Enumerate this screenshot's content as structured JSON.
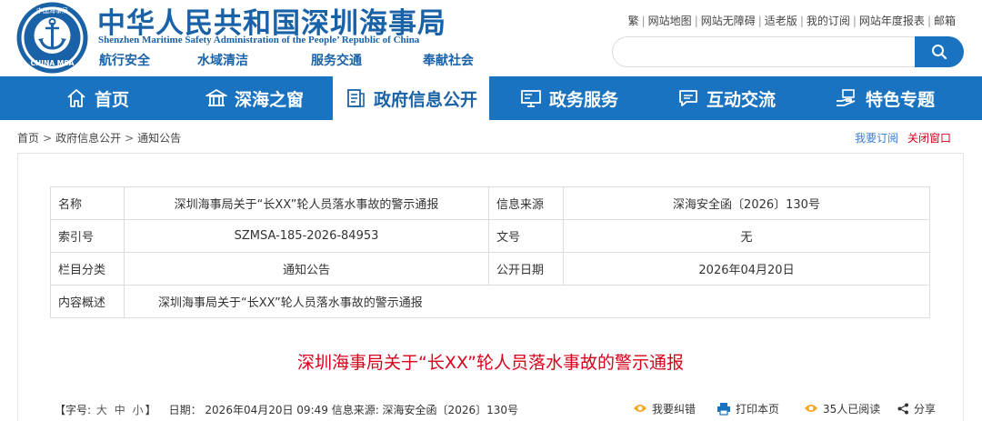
{
  "header": {
    "logo_text": "CHINA MSA",
    "logo_inner_text": "中国海事局",
    "title": "中华人民共和国深圳海事局",
    "subtitle": "Shenzhen Maritime Safety Administration of the People’ Republic of China",
    "slogans": [
      "航行安全",
      "水域清洁",
      "服务交通",
      "奉献社会"
    ]
  },
  "top_links": [
    "繁",
    "网站地图",
    "网站无障碍",
    "适老版",
    "我的订阅",
    "网站年度报表",
    "邮箱"
  ],
  "search": {
    "placeholder": "",
    "value": ""
  },
  "nav": [
    {
      "label": "首页",
      "icon": "home-icon"
    },
    {
      "label": "深海之窗",
      "icon": "building-icon"
    },
    {
      "label": "政府信息公开",
      "icon": "document-icon",
      "active": true
    },
    {
      "label": "政务服务",
      "icon": "monitor-icon"
    },
    {
      "label": "互动交流",
      "icon": "chat-icon"
    },
    {
      "label": "特色专题",
      "icon": "hand-icon"
    }
  ],
  "breadcrumb": [
    "首页",
    "政府信息公开",
    "通知公告"
  ],
  "right_actions": {
    "subscribe": "我要订阅",
    "close": "关闭窗口"
  },
  "meta": {
    "name_label": "名称",
    "name_value": "深圳海事局关于“长XX”轮人员落水事故的警示通报",
    "source_label": "信息来源",
    "source_value": "深海安全函〔2026〕130号",
    "index_label": "索引号",
    "index_value": "SZMSA-185-2026-84953",
    "docno_label": "文号",
    "docno_value": "无",
    "category_label": "栏目分类",
    "category_value": "通知公告",
    "pubdate_label": "公开日期",
    "pubdate_value": "2026年04月20日",
    "summary_label": "内容概述",
    "summary_value": "深圳海事局关于“长XX”轮人员落水事故的警示通报"
  },
  "doc_title": "深圳海事局关于“长XX”轮人员落水事故的警示通报",
  "info_bar": {
    "font_prefix": "【字号:",
    "font_sizes": [
      "大",
      "中",
      "小"
    ],
    "font_suffix": "】",
    "date_text": "日期： 2026年04月20日 09:49 信息来源: 深海安全函〔2026〕130号"
  },
  "tools": {
    "correct": "我要纠错",
    "print": "打印本页",
    "read": "35人已阅读",
    "share": "分享"
  },
  "colors": {
    "primary": "#1a73c0",
    "title_blue": "#1a62a8",
    "accent_red": "#d9001b",
    "link_blue": "#3a7bd5"
  }
}
